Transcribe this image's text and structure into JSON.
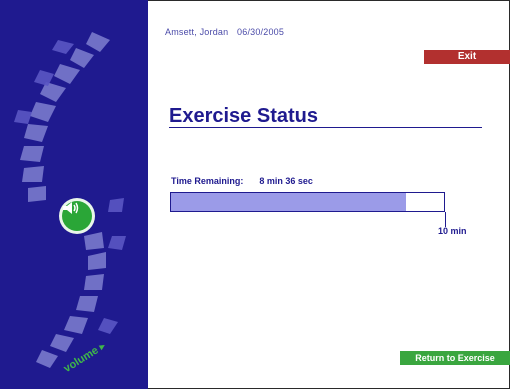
{
  "header": {
    "user_name": "Amsett, Jordan",
    "date": "06/30/2005"
  },
  "exit_label": "Exit",
  "title": "Exercise Status",
  "time": {
    "label": "Time Remaining:",
    "value": "8 min 36 sec",
    "progress_fraction": 0.86,
    "max_label": "10 min"
  },
  "sidebar": {
    "volume_label": "volume",
    "volume_arrow": "▸",
    "speaker_icon": "speaker-icon"
  },
  "return_label": "Return to Exercise",
  "colors": {
    "sidebar_bg": "#1f1a8f",
    "accent_red": "#b2302f",
    "accent_green": "#3aa63f",
    "progress_fill": "#9b9be8"
  }
}
